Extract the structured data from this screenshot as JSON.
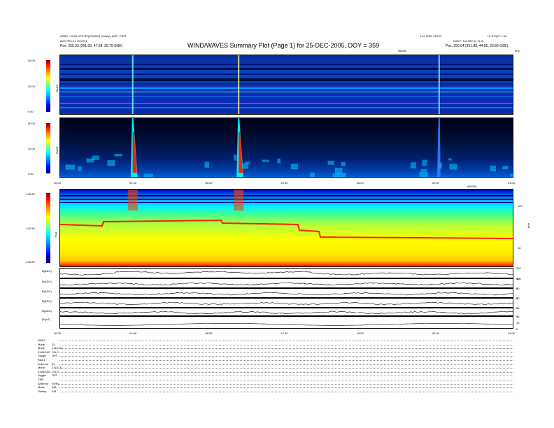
{
  "header": {
    "title": "WIND/WAVES Summary Plot (Page 1) for 25-DEC-2005, DOY = 359",
    "left_line1": "AOS0 = 2005 DPC BF(000/000) (Yearly): AFE / PSFF",
    "left_line2": "AVS FR3-2 x 1DV201",
    "left_line3": "Pos: 255.33 (251.00, 47.58, 20.79 GSE)",
    "right_line1": "L2 S7Q0Y x 60",
    "right_line2": "DAILY: Tue 359 (0, 0) x0",
    "right_line3": "Pos: 255.64 (251.88, 44.55, 20.89 GSE)",
    "center_small": "1.10 WED 2UT02",
    "rad2_units": "TBUNK",
    "rad2_units_right": "kHz",
    "tnr_units": "kHz"
  },
  "panels": {
    "rad2": {
      "label": "RAD2",
      "ticks": [
        "40.00",
        "20.00",
        "0.00"
      ]
    },
    "rad1": {
      "label": "RAD1",
      "ticks": [
        "50.00",
        "30.00",
        "0.00"
      ]
    },
    "tnr": {
      "label": "TNR",
      "ticks": [
        "-130.00",
        "-142.50",
        "-155.00"
      ],
      "right_ticks": [
        "100",
        "10"
      ]
    },
    "time_axis_top": [
      "00:00",
      "04:00",
      "08:00",
      "12:00",
      "16:00",
      "20:00",
      "24:00"
    ],
    "time_axis_label": "8/8/255",
    "line_panels": [
      {
        "label": "B(ADC)",
        "right": [
          "200",
          "100"
        ]
      },
      {
        "label": "B(ADC)",
        "right": [
          "50",
          "0"
        ]
      },
      {
        "label": "B(ADC)",
        "right": [
          "50",
          "0"
        ]
      },
      {
        "label": "B(ADC)",
        "right": [
          "50",
          "0"
        ]
      },
      {
        "label": "N(ADC)",
        "right": [
          "10",
          "0"
        ]
      },
      {
        "label": "|B|(nT)",
        "right": [
          "15",
          "10",
          "5"
        ]
      }
    ],
    "time_axis_bottom": [
      "00:00",
      "04:00",
      "08:00",
      "12:00",
      "16:00",
      "20:00",
      "24:00"
    ]
  },
  "footer": {
    "rows": [
      [
        "RAD2",
        ""
      ],
      [
        "Mode",
        "SL"
      ],
      [
        "Mode",
        "1-N(1.3)"
      ],
      [
        "3-ANOAS",
        "1SLP"
      ],
      [
        "Toggle",
        "OFF"
      ],
      [
        "RAD1",
        ""
      ],
      [
        "Antenna",
        "Ex"
      ],
      [
        "Mode",
        "1-N(1.3)"
      ],
      [
        "3-ANOAS",
        "1SLP"
      ],
      [
        "Toggle",
        "OFF"
      ],
      [
        "TNR",
        ""
      ],
      [
        "Antenna",
        "Ex/Ey"
      ],
      [
        "Mode",
        "A/B"
      ],
      [
        "Sweep",
        "A/B"
      ]
    ]
  },
  "chart_data": {
    "type": "heatmap",
    "title": "WIND/WAVES Summary Plot (Page 1) for 25-DEC-2005, DOY = 359",
    "x_ticks": [
      "00:00",
      "04:00",
      "08:00",
      "12:00",
      "16:00",
      "20:00",
      "24:00"
    ],
    "panels": [
      "RAD2",
      "RAD1",
      "TNR",
      "B(ADC)",
      "B(ADC)",
      "B(ADC)",
      "B(ADC)",
      "N(ADC)",
      "|B|(nT)"
    ],
    "burst_times_hours": [
      3.8,
      9.4,
      20.0
    ],
    "colors": {
      "low": "#000080",
      "mid": "#00ffff",
      "high": "#ff0000"
    }
  }
}
